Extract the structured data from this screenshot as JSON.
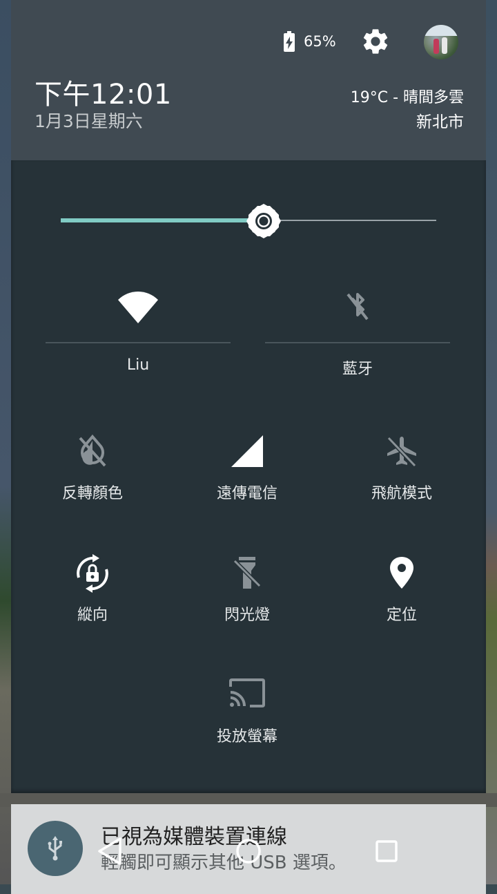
{
  "status": {
    "battery_percent": "65%",
    "battery_icon": "battery-charging-icon",
    "settings_icon": "gear-icon",
    "avatar": "user-avatar"
  },
  "clock": {
    "time": "下午12:01",
    "date": "1月3日星期六"
  },
  "weather": {
    "summary": "19°C - 晴間多雲",
    "city": "新北市"
  },
  "brightness": {
    "level": 0.54,
    "icon": "brightness-icon"
  },
  "tiles_top": [
    {
      "label": "Liu",
      "icon": "wifi-icon",
      "active": true
    },
    {
      "label": "藍牙",
      "icon": "bluetooth-off-icon",
      "active": false
    }
  ],
  "tiles": [
    {
      "label": "反轉顏色",
      "icon": "invert-colors-off-icon",
      "active": false
    },
    {
      "label": "遠傳電信",
      "icon": "cellular-signal-icon",
      "active": true
    },
    {
      "label": "飛航模式",
      "icon": "airplane-off-icon",
      "active": false
    },
    {
      "label": "縱向",
      "icon": "rotation-lock-icon",
      "active": true
    },
    {
      "label": "閃光燈",
      "icon": "flashlight-off-icon",
      "active": false
    },
    {
      "label": "定位",
      "icon": "location-icon",
      "active": true
    },
    {
      "label": "投放螢幕",
      "icon": "cast-icon",
      "active": false
    }
  ],
  "notification": {
    "title": "已視為媒體裝置連線",
    "text": "輕觸即可顯示其他 USB 選項。",
    "icon": "usb-icon"
  },
  "nav": {
    "back": "back-icon",
    "home": "home-icon",
    "recents": "recents-icon"
  },
  "colors": {
    "panel": "#263238",
    "header": "#404a52",
    "accent": "#80cbc4"
  }
}
